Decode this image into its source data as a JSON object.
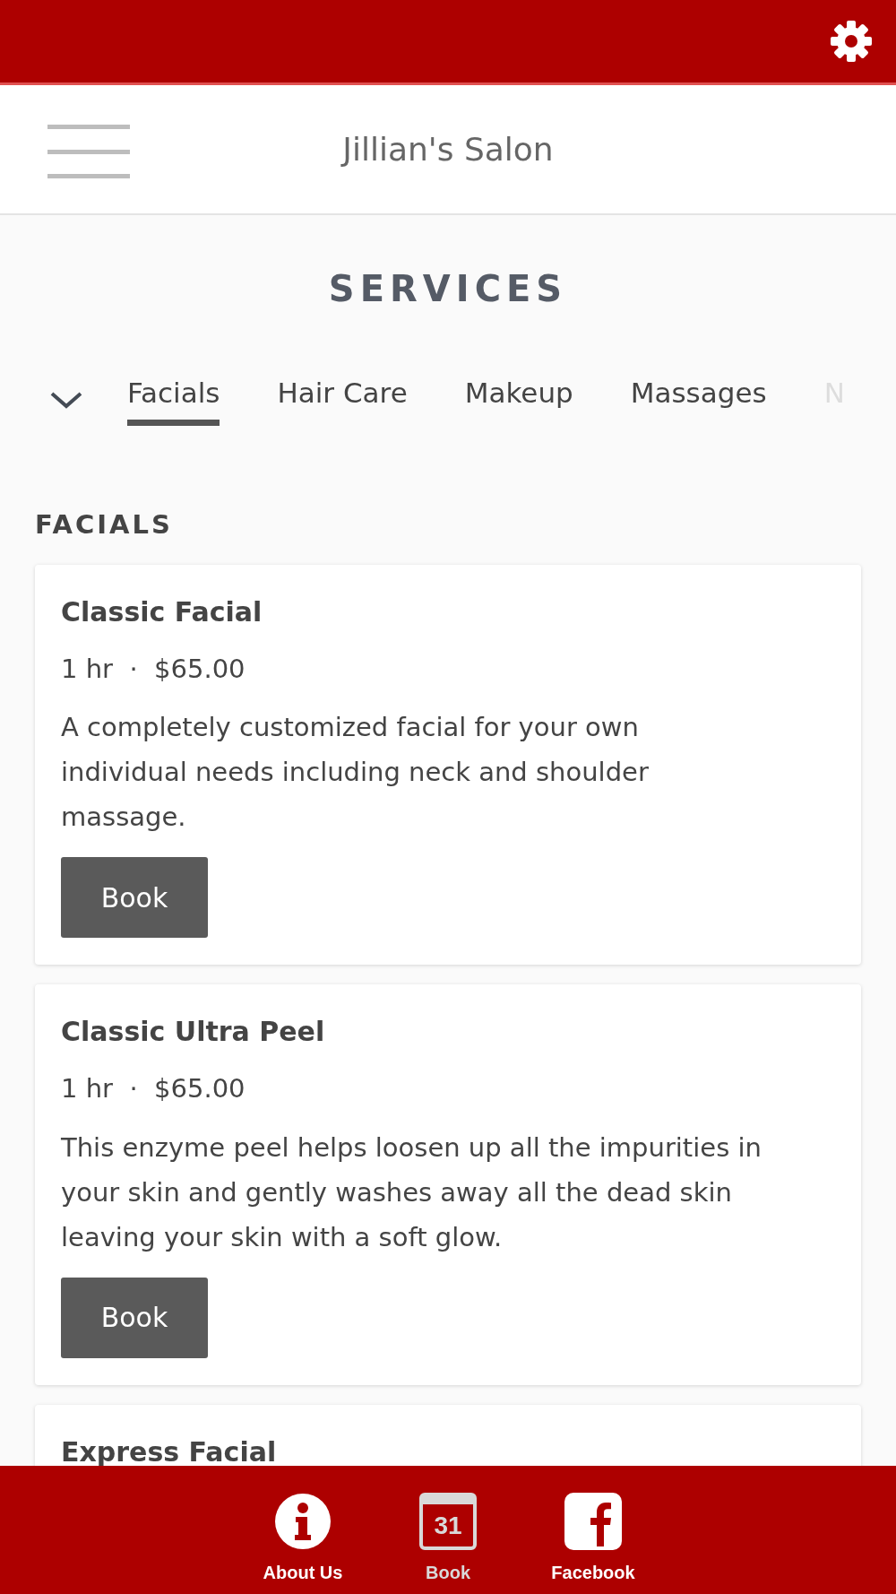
{
  "header": {
    "title": "Jillian's Salon"
  },
  "page_title": "SERVICES",
  "tabs": [
    {
      "label": "Facials",
      "selected": true
    },
    {
      "label": "Hair Care",
      "selected": false
    },
    {
      "label": "Makeup",
      "selected": false
    },
    {
      "label": "Massages",
      "selected": false
    },
    {
      "label": "N",
      "selected": false,
      "faded": true
    }
  ],
  "section_title": "FACIALS",
  "services": [
    {
      "name": "Classic Facial",
      "meta": "1 hr  ·  $65.00",
      "description": "A completely customized facial for your own individual needs including neck and shoulder massage.",
      "button": "Book"
    },
    {
      "name": "Classic Ultra Peel",
      "meta": "1 hr  ·  $65.00",
      "description": "This enzyme peel helps loosen up all the impurities in your skin and gently washes away all the dead skin leaving your skin with a soft glow.",
      "button": "Book"
    },
    {
      "name": "Express Facial"
    }
  ],
  "bottom_nav": [
    {
      "label": "About Us",
      "kind": "info",
      "selected": false
    },
    {
      "label": "Book",
      "kind": "calendar",
      "icon_text": "31",
      "selected": true
    },
    {
      "label": "Facebook",
      "kind": "facebook",
      "selected": false
    }
  ]
}
